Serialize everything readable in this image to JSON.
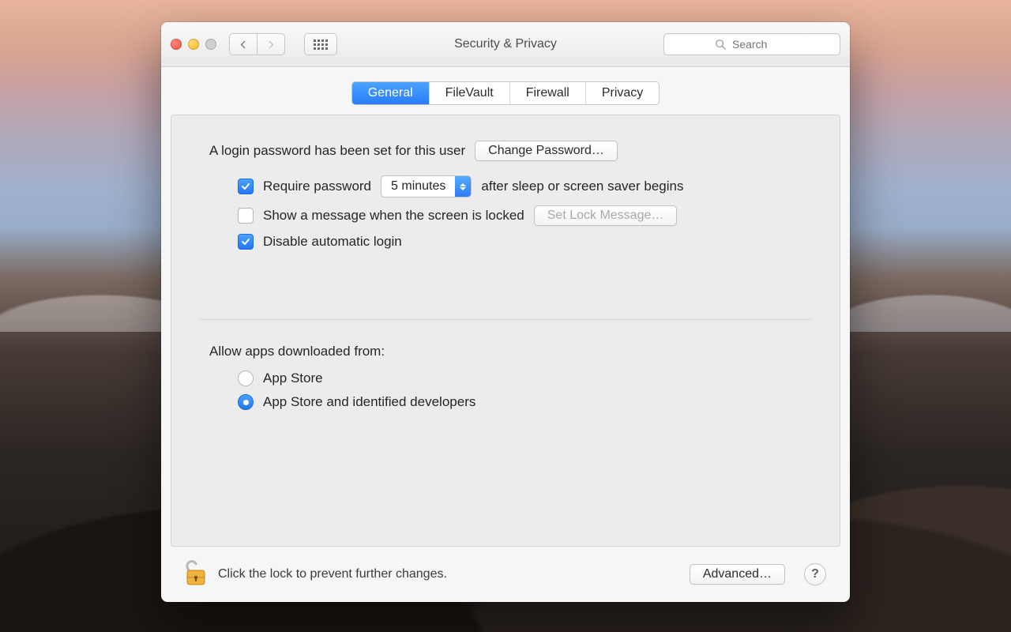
{
  "window": {
    "title": "Security & Privacy"
  },
  "search": {
    "placeholder": "Search"
  },
  "tabs": [
    {
      "label": "General",
      "active": true
    },
    {
      "label": "FileVault",
      "active": false
    },
    {
      "label": "Firewall",
      "active": false
    },
    {
      "label": "Privacy",
      "active": false
    }
  ],
  "login_section": {
    "password_set_text": "A login password has been set for this user",
    "change_password_btn": "Change Password…",
    "require_password_label": "Require password",
    "require_password_checked": true,
    "delay_value": "5 minutes",
    "after_sleep_text": "after sleep or screen saver begins",
    "show_message_label": "Show a message when the screen is locked",
    "show_message_checked": false,
    "set_lock_message_btn": "Set Lock Message…",
    "set_lock_message_disabled": true,
    "disable_auto_login_label": "Disable automatic login",
    "disable_auto_login_checked": true
  },
  "gatekeeper": {
    "heading": "Allow apps downloaded from:",
    "options": [
      {
        "label": "App Store",
        "selected": false
      },
      {
        "label": "App Store and identified developers",
        "selected": true
      }
    ]
  },
  "footer": {
    "lock_text": "Click the lock to prevent further changes.",
    "advanced_btn": "Advanced…",
    "help": "?"
  }
}
